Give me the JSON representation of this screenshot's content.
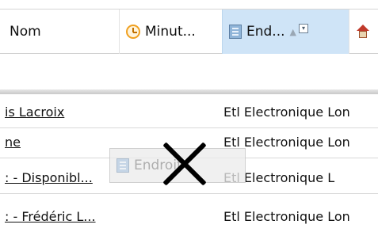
{
  "header": {
    "columns": [
      {
        "label": "Nom"
      },
      {
        "label": "Minut..."
      },
      {
        "label": "End..."
      }
    ]
  },
  "rows": [
    {
      "name": "is Lacroix",
      "org": "Etl Electronique Lon"
    },
    {
      "name": "ne",
      "org": "Etl Electronique Lon"
    },
    {
      "name": ": - Disponibl...",
      "org": "Etl Electronique L"
    },
    {
      "name": ": - Frédéric L...",
      "org": "Etl Electronique Lon"
    }
  ],
  "drag_ghost": {
    "label": "Endroit"
  },
  "icons": {
    "minutes": "clock-icon",
    "endroit": "building-icon",
    "home": "house-icon",
    "drop": "no-drop-cross-icon"
  },
  "colors": {
    "selected_header": "#cfe4f7"
  }
}
